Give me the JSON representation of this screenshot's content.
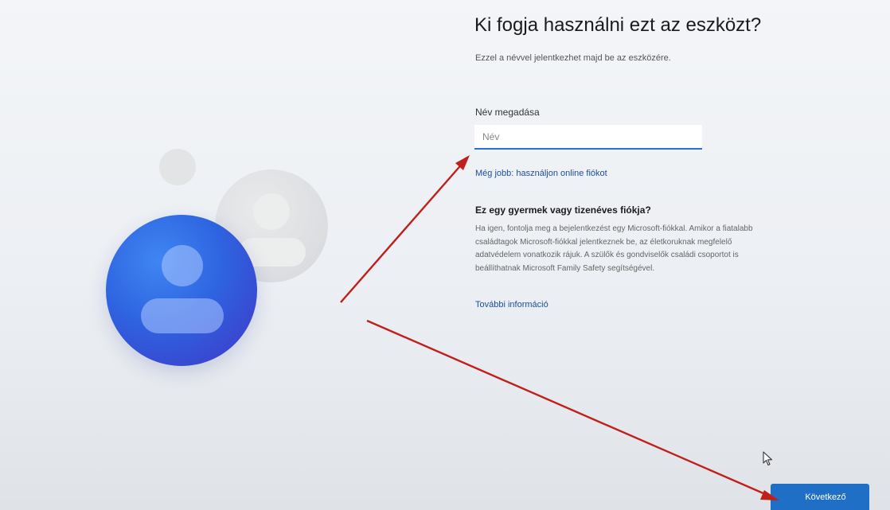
{
  "page": {
    "title": "Ki fogja használni ezt az eszközt?",
    "subtitle": "Ezzel a névvel jelentkezhet majd be az eszközére."
  },
  "form": {
    "name_label": "Név megadása",
    "name_placeholder": "Név",
    "name_value": "",
    "online_account_link": "Még jobb: használjon online fiókot"
  },
  "info": {
    "heading": "Ez egy gyermek vagy tizenéves fiókja?",
    "body_lines": [
      "Ha igen, fontolja meg a bejelentkezést egy Microsoft-fiókkal. Amikor a fiatalabb",
      "családtagok Microsoft-fiókkal jelentkeznek be, az életkoruknak megfelelő",
      "adatvédelem vonatkozik rájuk. A szülők és gondviselők családi csoportot is",
      "beállíthatnak Microsoft Family Safety segítségével."
    ],
    "more_link": "További információ"
  },
  "footer": {
    "next_button": "Következő"
  },
  "icons": {
    "avatar_primary": "user-avatar-icon",
    "avatar_secondary": "user-avatar-icon",
    "cursor": "mouse-pointer-icon"
  },
  "colors": {
    "accent": "#1f6fc6",
    "link": "#1a4f9e",
    "annotation_arrow": "#c0201c",
    "avatar_blue": "#2e63e0"
  }
}
